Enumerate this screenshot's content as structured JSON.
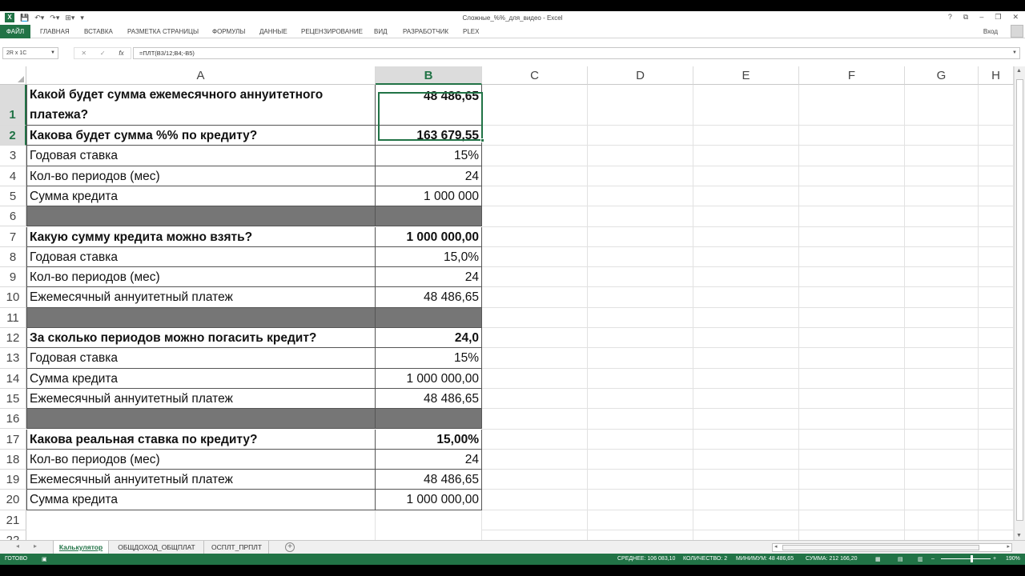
{
  "window": {
    "title": "Сложные_%%_для_видео - Excel",
    "controls": [
      "?",
      "⧉",
      "–",
      "❐",
      "✕"
    ]
  },
  "ribbon": {
    "tabs": [
      "ФАЙЛ",
      "ГЛАВНАЯ",
      "ВСТАВКА",
      "РАЗМЕТКА СТРАНИЦЫ",
      "ФОРМУЛЫ",
      "ДАННЫЕ",
      "РЕЦЕНЗИРОВАНИЕ",
      "ВИД",
      "РАЗРАБОТЧИК",
      "PLEX"
    ],
    "login": "Вход"
  },
  "formula_bar": {
    "name_box": "2R x 1C",
    "fx": "fx",
    "formula": "=ПЛТ(B3/12;B4;-B5)"
  },
  "columns": [
    "A",
    "B",
    "C",
    "D",
    "E",
    "F",
    "G",
    "H"
  ],
  "rows": [
    {
      "n": "1",
      "a": "Какой будет сумма ежемесячного аннуитетного платежа?",
      "b": "48 486,65",
      "bold": true
    },
    {
      "n": "2",
      "a": "Какова будет сумма %% по кредиту?",
      "b": "163 679,55",
      "bold": true
    },
    {
      "n": "3",
      "a": "Годовая ставка",
      "b": "15%"
    },
    {
      "n": "4",
      "a": "Кол-во периодов (мес)",
      "b": "24"
    },
    {
      "n": "5",
      "a": "Сумма кредита",
      "b": "1 000 000"
    },
    {
      "n": "6",
      "a": "",
      "b": "",
      "dark": true
    },
    {
      "n": "7",
      "a": "Какую сумму кредита можно взять?",
      "b": "1 000 000,00",
      "bold": true
    },
    {
      "n": "8",
      "a": "Годовая ставка",
      "b": "15,0%"
    },
    {
      "n": "9",
      "a": "Кол-во периодов (мес)",
      "b": "24"
    },
    {
      "n": "10",
      "a": "Ежемесячный аннуитетный платеж",
      "b": "48 486,65"
    },
    {
      "n": "11",
      "a": "",
      "b": "",
      "dark": true
    },
    {
      "n": "12",
      "a": "За сколько периодов можно погасить кредит?",
      "b": "24,0",
      "bold": true
    },
    {
      "n": "13",
      "a": "Годовая ставка",
      "b": "15%"
    },
    {
      "n": "14",
      "a": "Сумма кредита",
      "b": "1 000 000,00"
    },
    {
      "n": "15",
      "a": "Ежемесячный аннуитетный платеж",
      "b": "48 486,65"
    },
    {
      "n": "16",
      "a": "",
      "b": "",
      "dark": true
    },
    {
      "n": "17",
      "a": "Какова реальная ставка по кредиту?",
      "b": "15,00%",
      "bold": true
    },
    {
      "n": "18",
      "a": "Кол-во периодов (мес)",
      "b": "24"
    },
    {
      "n": "19",
      "a": "Ежемесячный аннуитетный платеж",
      "b": "48 486,65"
    },
    {
      "n": "20",
      "a": "Сумма кредита",
      "b": "1 000 000,00"
    },
    {
      "n": "21",
      "a": "",
      "b": ""
    },
    {
      "n": "22",
      "a": "",
      "b": ""
    }
  ],
  "sheets": {
    "tabs": [
      "Калькулятор",
      "ОБЩДОХОД_ОБЩПЛАТ",
      "ОСПЛТ_ПРПЛТ"
    ],
    "active": 0,
    "add": "+"
  },
  "status": {
    "mode": "ГОТОВО",
    "average": "СРЕДНЕЕ: 106 083,10",
    "count": "КОЛИЧЕСТВО: 2",
    "min": "МИНИМУМ: 48 486,65",
    "sum": "СУММА: 212 166,20",
    "zoom": "190%"
  },
  "colors": {
    "accent": "#217346",
    "dark_row": "#767676"
  }
}
